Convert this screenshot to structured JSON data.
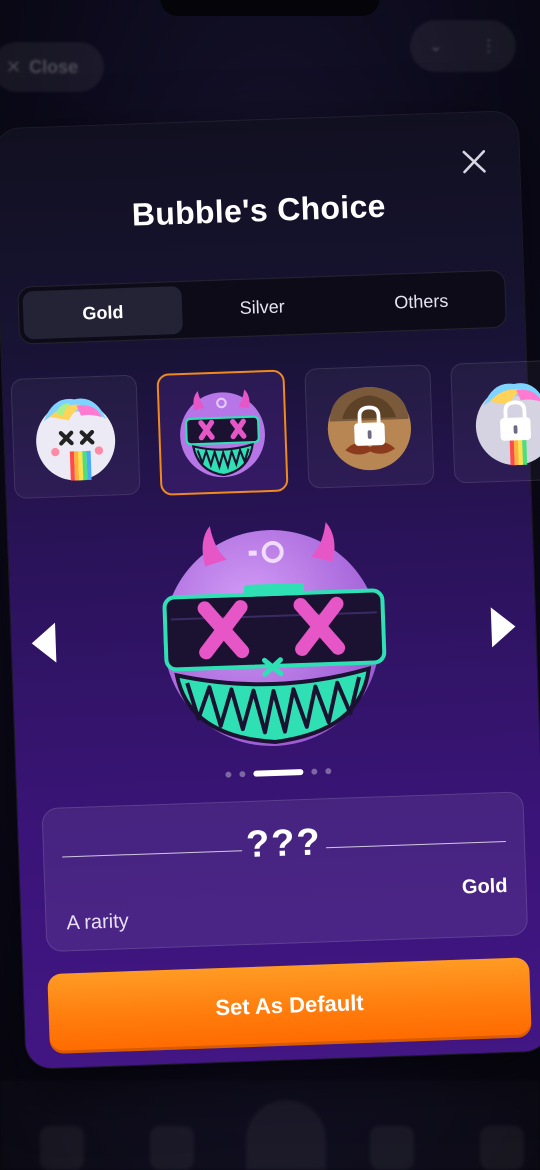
{
  "header": {
    "close_label": "Close"
  },
  "modal": {
    "title": "Bubble's Choice",
    "tabs": [
      {
        "label": "Gold",
        "active": true
      },
      {
        "label": "Silver",
        "active": false
      },
      {
        "label": "Others",
        "active": false
      }
    ],
    "avatars": [
      {
        "name": "rainbow-unicorn-avatar",
        "locked": false,
        "selected": false
      },
      {
        "name": "purple-devil-grin-avatar",
        "locked": false,
        "selected": true
      },
      {
        "name": "mustache-helmet-avatar",
        "locked": true,
        "selected": false
      },
      {
        "name": "rainbow-unicorn-variant-avatar",
        "locked": true,
        "selected": false
      }
    ],
    "carousel": {
      "page_count": 5,
      "active_index": 2
    },
    "details": {
      "name": "???",
      "tier": "Gold",
      "rarity": "A rarity"
    },
    "cta_label": "Set As Default"
  },
  "colors": {
    "accent": "#ff7b0b",
    "selected_border": "#f08a1c",
    "avatar_purple": "#b776e8",
    "avatar_teal": "#2fe0b5",
    "avatar_pink": "#e756c6"
  }
}
